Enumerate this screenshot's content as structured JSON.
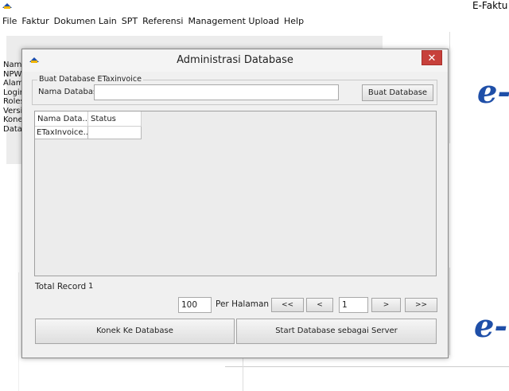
{
  "app": {
    "title": "E-Faktu",
    "menu": [
      "File",
      "Faktur",
      "Dokumen Lain",
      "SPT",
      "Referensi",
      "Management Upload",
      "Help"
    ],
    "info_labels": [
      "Nama",
      "NPWI",
      "Alam",
      "Login",
      "Roles",
      "Versi",
      "Konek",
      "Data"
    ],
    "logo_top": "e-",
    "logo_bottom": "e-"
  },
  "dialog": {
    "title": "Administrasi Database",
    "close": "✕",
    "group_legend": "Buat Database ETaxinvoice",
    "field_label": "Nama Database",
    "field_value": "",
    "create_button": "Buat Database",
    "table": {
      "columns": [
        "Nama Data...",
        "Status"
      ],
      "rows": [
        [
          "ETaxInvoice...",
          ""
        ]
      ]
    },
    "total_label": "Total Record",
    "total_value": "1",
    "per_page_value": "100",
    "per_page_label": "Per Halaman",
    "nav_first": "<<",
    "nav_prev": "<",
    "page_value": "1",
    "nav_next": ">",
    "nav_last": ">>",
    "connect_button": "Konek Ke Database",
    "server_button": "Start Database sebagai Server"
  }
}
